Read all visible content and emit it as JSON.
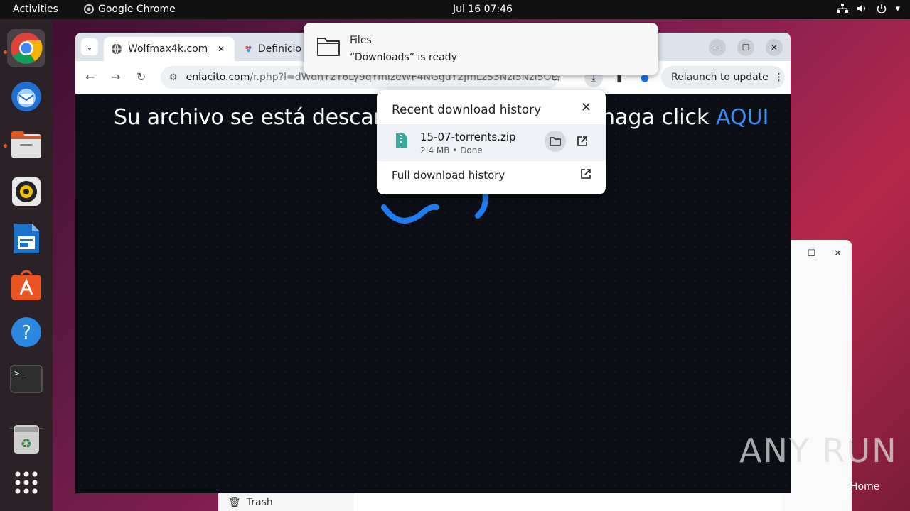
{
  "topbar": {
    "activities": "Activities",
    "app_name": "Google Chrome",
    "clock": "Jul 16  07:46"
  },
  "dock": {
    "items": [
      "chrome-icon",
      "thunderbird-icon",
      "files-icon",
      "rhythmbox-icon",
      "writer-icon",
      "app-center-icon",
      "help-icon",
      "terminal-icon",
      "trash-icon",
      "app-grid-icon"
    ]
  },
  "browser": {
    "tabs": [
      {
        "label": "Wolfmax4k.com",
        "favicon": "globe-icon"
      },
      {
        "label": "Definicio",
        "favicon": "puzzle-icon"
      }
    ],
    "omnibox": {
      "host": "enlacito.com",
      "path": "/r.php?l=dWdhY2Y6Ly9qYmlzeWF4NGguY2JmLzS3NzI5NzI5OL..."
    },
    "relaunch_label": "Relaunch to update"
  },
  "page": {
    "headline_left": "Su archivo se está descarga",
    "headline_right": "haga click ",
    "headline_link": "AQUI",
    "link_color": "#3c8ef7"
  },
  "notification": {
    "app": "Files",
    "message": "“Downloads” is ready"
  },
  "downloads": {
    "title": "Recent download history",
    "item": {
      "filename": "15-07-torrents.zip",
      "meta": "2.4 MB • Done"
    },
    "full_history": "Full download history"
  },
  "background": {
    "trash_label": "Trash",
    "home_label": "Home"
  },
  "watermark": "ANY RUN"
}
